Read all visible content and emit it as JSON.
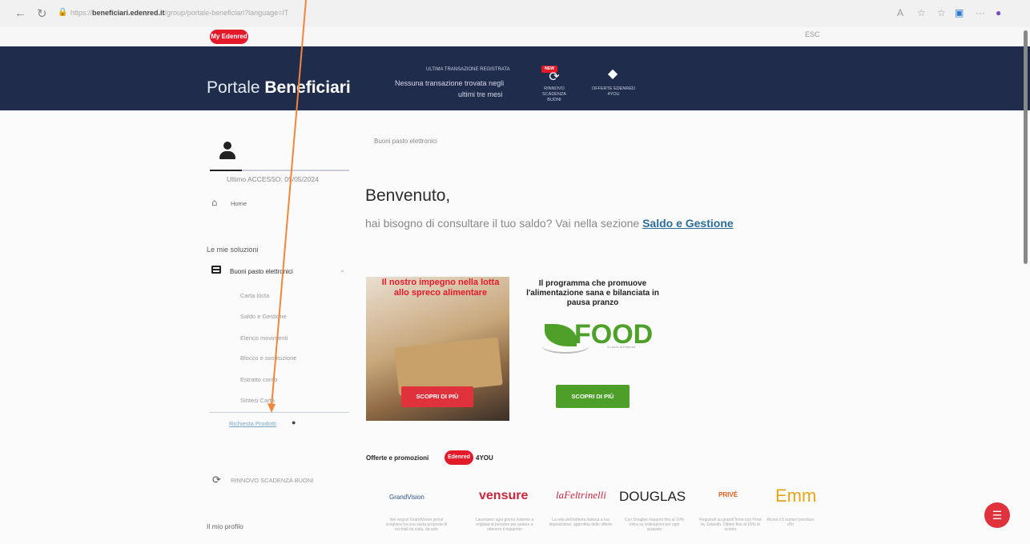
{
  "browser": {
    "url_prefix": "https://",
    "url_host": "beneficiari.edenred.it",
    "url_path": "/group/portale-beneficiari?language=IT"
  },
  "site": {
    "logo_text": "My Edenred",
    "esc_label": "ESC"
  },
  "banner": {
    "title_light": "Portale ",
    "title_bold": "Beneficiari",
    "last_tx_heading": "ULTIMA TRANSAZIONE REGISTRATA",
    "last_tx_line1": "Nessuna transazione trovata negli",
    "last_tx_line2": "ultimi tre mesi",
    "new_badge": "NEW",
    "renew_label": "RINNOVO SCADENZA BUONI",
    "offers_label": "OFFERTE EDENRED 4YOU"
  },
  "sidebar": {
    "last_access": "Ultimo ACCESSO: 05/05/2024",
    "home": "Home",
    "section_title": "Le mie soluzioni",
    "product": "Buoni pasto elettronici",
    "subitems": [
      "Carta lócta",
      "Saldo e Gestione",
      "Elenco movimenti",
      "Blocco e sostituzione",
      "Estratto conto",
      "Sintesi Carta"
    ],
    "request_label": "Richiesta Prodotti",
    "renew": "RINNOVO SCADENZA BUONI",
    "profile": "Il mio profilo"
  },
  "main": {
    "breadcrumb": "Buoni pasto elettronici",
    "welcome": "Benvenuto,",
    "hint_text": "hai bisogno di consultare il tuo saldo? Vai nella sezione ",
    "hint_link": "Saldo e Gestione",
    "promo1_title": "Il nostro impegno nella lotta allo spreco alimentare",
    "promo1_button": "SCOPRI DI PIÙ",
    "promo2_title": "Il programma che promuove l'alimentazione sana e bilanciata in pausa pranzo",
    "promo2_logo": "FOOD",
    "promo2_sub": "A Lunch at Edenred",
    "promo2_button": "SCOPRI DI PIÙ",
    "offers_title": "Offerte e promozioni",
    "offers_logo": "Edenred",
    "offers_4you": "4YOU"
  },
  "brands": [
    {
      "name": "GrandVision",
      "desc": "Nei negozi GrandVision potrai scegliere tra una vasta proposta di occhiali da vista, da sole"
    },
    {
      "name": "vensure",
      "desc": "Lavoriamo ogni giorno insieme a migliaia di persone per aiutare a ottenere il risparmio"
    },
    {
      "name": "laFeltrinelli",
      "desc": "La rete dell'editoria italiana a tua disposizione: approfitta delle offerte"
    },
    {
      "name": "DOUGLAS",
      "desc": "Con Douglas risparmi fino al 10% extra su ordinazioni per ogni acquisto"
    },
    {
      "name": "PRIVÉ",
      "desc": "Registrati su grandi firme con Privé by Zalando. Ottieni fino al 10% di sconto"
    },
    {
      "name": "Emm",
      "desc": "Ricevi il 5 numeri premium d'Iti"
    }
  ],
  "colors": {
    "navy": "#1f2c4c",
    "brand_red": "#e4192a",
    "food_green": "#4da028",
    "link_blue": "#2b6e9e"
  }
}
